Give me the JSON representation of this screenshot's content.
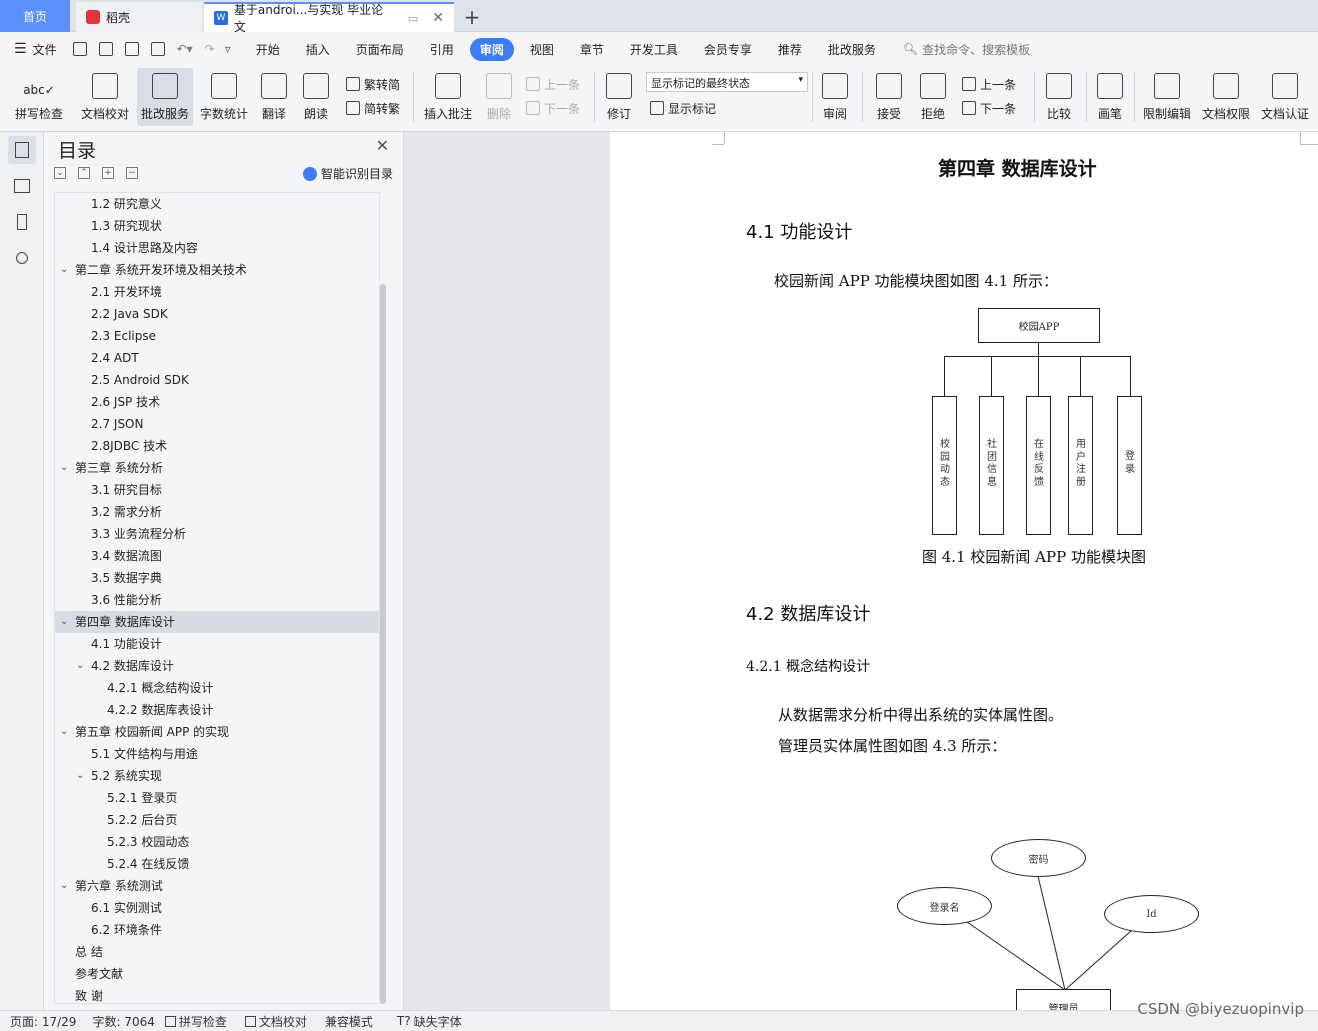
{
  "tabs": {
    "home": "首页",
    "daoke": "稻壳",
    "doc": "基于androi...与实现 毕业论文",
    "close": "✕",
    "add": "+"
  },
  "menu": {
    "file": "文件",
    "items": [
      "开始",
      "插入",
      "页面布局",
      "引用",
      "审阅",
      "视图",
      "章节",
      "开发工具",
      "会员专享",
      "推荐",
      "批改服务"
    ],
    "active_index": 4,
    "search": "查找命令、搜索模板"
  },
  "ribbon": {
    "spell_check": "拼写检查",
    "doc_proof": "文档校对",
    "review_service": "批改服务",
    "word_count": "字数统计",
    "translate": "翻译",
    "read_aloud": "朗读",
    "trad_to_simp": "繁转简",
    "simp_to_trad": "简转繁",
    "insert_comment": "插入批注",
    "delete": "删除",
    "prev_comment": "上一条",
    "next_comment": "下一条",
    "track_changes": "修订",
    "markup_state": "显示标记的最终状态",
    "show_markup": "显示标记",
    "review": "审阅",
    "accept": "接受",
    "reject": "拒绝",
    "prev_change": "上一条",
    "next_change": "下一条",
    "compare": "比较",
    "pen": "画笔",
    "restrict_edit": "限制编辑",
    "doc_permission": "文档权限",
    "doc_cert": "文档认证"
  },
  "toc": {
    "title": "目录",
    "smart": "智能识别目录",
    "items": [
      {
        "label": "1.2 研究意义",
        "level": 2
      },
      {
        "label": "1.3 研究现状",
        "level": 2
      },
      {
        "label": "1.4 设计思路及内容",
        "level": 2
      },
      {
        "label": "第二章 系统开发环境及相关技术",
        "level": 1,
        "expanded": true
      },
      {
        "label": "2.1 开发环境",
        "level": 2
      },
      {
        "label": "2.2 Java SDK",
        "level": 2
      },
      {
        "label": "2.3 Eclipse",
        "level": 2
      },
      {
        "label": "2.4 ADT",
        "level": 2
      },
      {
        "label": "2.5 Android SDK",
        "level": 2
      },
      {
        "label": "2.6 JSP 技术",
        "level": 2
      },
      {
        "label": "2.7 JSON",
        "level": 2
      },
      {
        "label": "2.8JDBC 技术",
        "level": 2
      },
      {
        "label": "第三章 系统分析",
        "level": 1,
        "expanded": true
      },
      {
        "label": "3.1 研究目标",
        "level": 2
      },
      {
        "label": "3.2 需求分析",
        "level": 2
      },
      {
        "label": "3.3 业务流程分析",
        "level": 2
      },
      {
        "label": "3.4 数据流图",
        "level": 2
      },
      {
        "label": "3.5 数据字典",
        "level": 2
      },
      {
        "label": "3.6 性能分析",
        "level": 2
      },
      {
        "label": "第四章 数据库设计",
        "level": 1,
        "expanded": true,
        "selected": true
      },
      {
        "label": "4.1 功能设计",
        "level": 2
      },
      {
        "label": "4.2 数据库设计",
        "level": 2,
        "expanded": true
      },
      {
        "label": "4.2.1 概念结构设计",
        "level": 3
      },
      {
        "label": "4.2.2 数据库表设计",
        "level": 3
      },
      {
        "label": "第五章 校园新闻 APP 的实现",
        "level": 1,
        "expanded": true
      },
      {
        "label": "5.1 文件结构与用途",
        "level": 2
      },
      {
        "label": "5.2 系统实现",
        "level": 2,
        "expanded": true
      },
      {
        "label": "5.2.1 登录页",
        "level": 3
      },
      {
        "label": "5.2.2 后台页",
        "level": 3
      },
      {
        "label": "5.2.3 校园动态",
        "level": 3
      },
      {
        "label": "5.2.4 在线反馈",
        "level": 3
      },
      {
        "label": "第六章 系统测试",
        "level": 1,
        "expanded": true
      },
      {
        "label": "6.1 实例测试",
        "level": 2
      },
      {
        "label": "6.2 环境条件",
        "level": 2
      },
      {
        "label": "总 结",
        "level": 1
      },
      {
        "label": "参考文献",
        "level": 1
      },
      {
        "label": "致 谢",
        "level": 1
      }
    ]
  },
  "document": {
    "chapter_title": "第四章 数据库设计",
    "s41": "4.1 功能设计",
    "p41": "校园新闻 APP 功能模块图如图 4.1 所示：",
    "diagram_root": "校园APP",
    "diagram_modules": [
      "校园动态",
      "社团信息",
      "在线反馈",
      "用户注册",
      "登录"
    ],
    "figure_caption": "图 4.1  校园新闻 APP 功能模块图",
    "s42": "4.2 数据库设计",
    "s421": "4.2.1 概念结构设计",
    "p421a": "从数据需求分析中得出系统的实体属性图。",
    "p421b": "管理员实体属性图如图 4.3 所示：",
    "er_password": "密码",
    "er_login": "登录名",
    "er_id": "Id",
    "er_entity": "管理员"
  },
  "status": {
    "page": "页面: 17/29",
    "words": "字数: 7064",
    "spell": "拼写检查",
    "proof": "文档校对",
    "compat": "兼容模式",
    "missing_font": "缺失字体"
  },
  "watermark": "CSDN @biyezuopinvip"
}
